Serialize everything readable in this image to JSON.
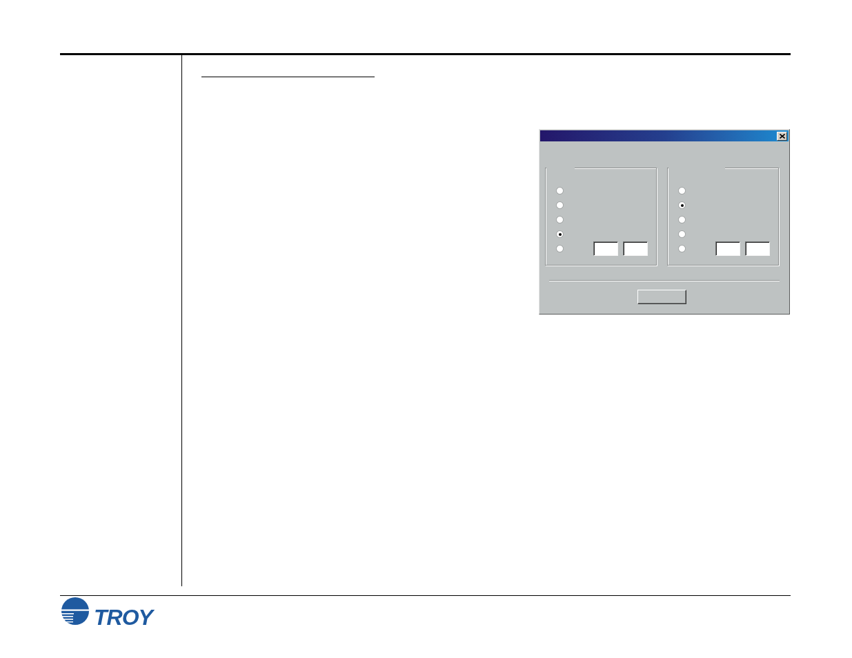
{
  "dialog": {
    "groups": [
      {
        "options": [
          {
            "selected": false
          },
          {
            "selected": false
          },
          {
            "selected": false
          },
          {
            "selected": true
          },
          {
            "selected": false
          }
        ]
      },
      {
        "options": [
          {
            "selected": false
          },
          {
            "selected": true
          },
          {
            "selected": false
          },
          {
            "selected": false
          },
          {
            "selected": false
          }
        ]
      }
    ]
  },
  "footer": {
    "logo_text": "TROY"
  }
}
